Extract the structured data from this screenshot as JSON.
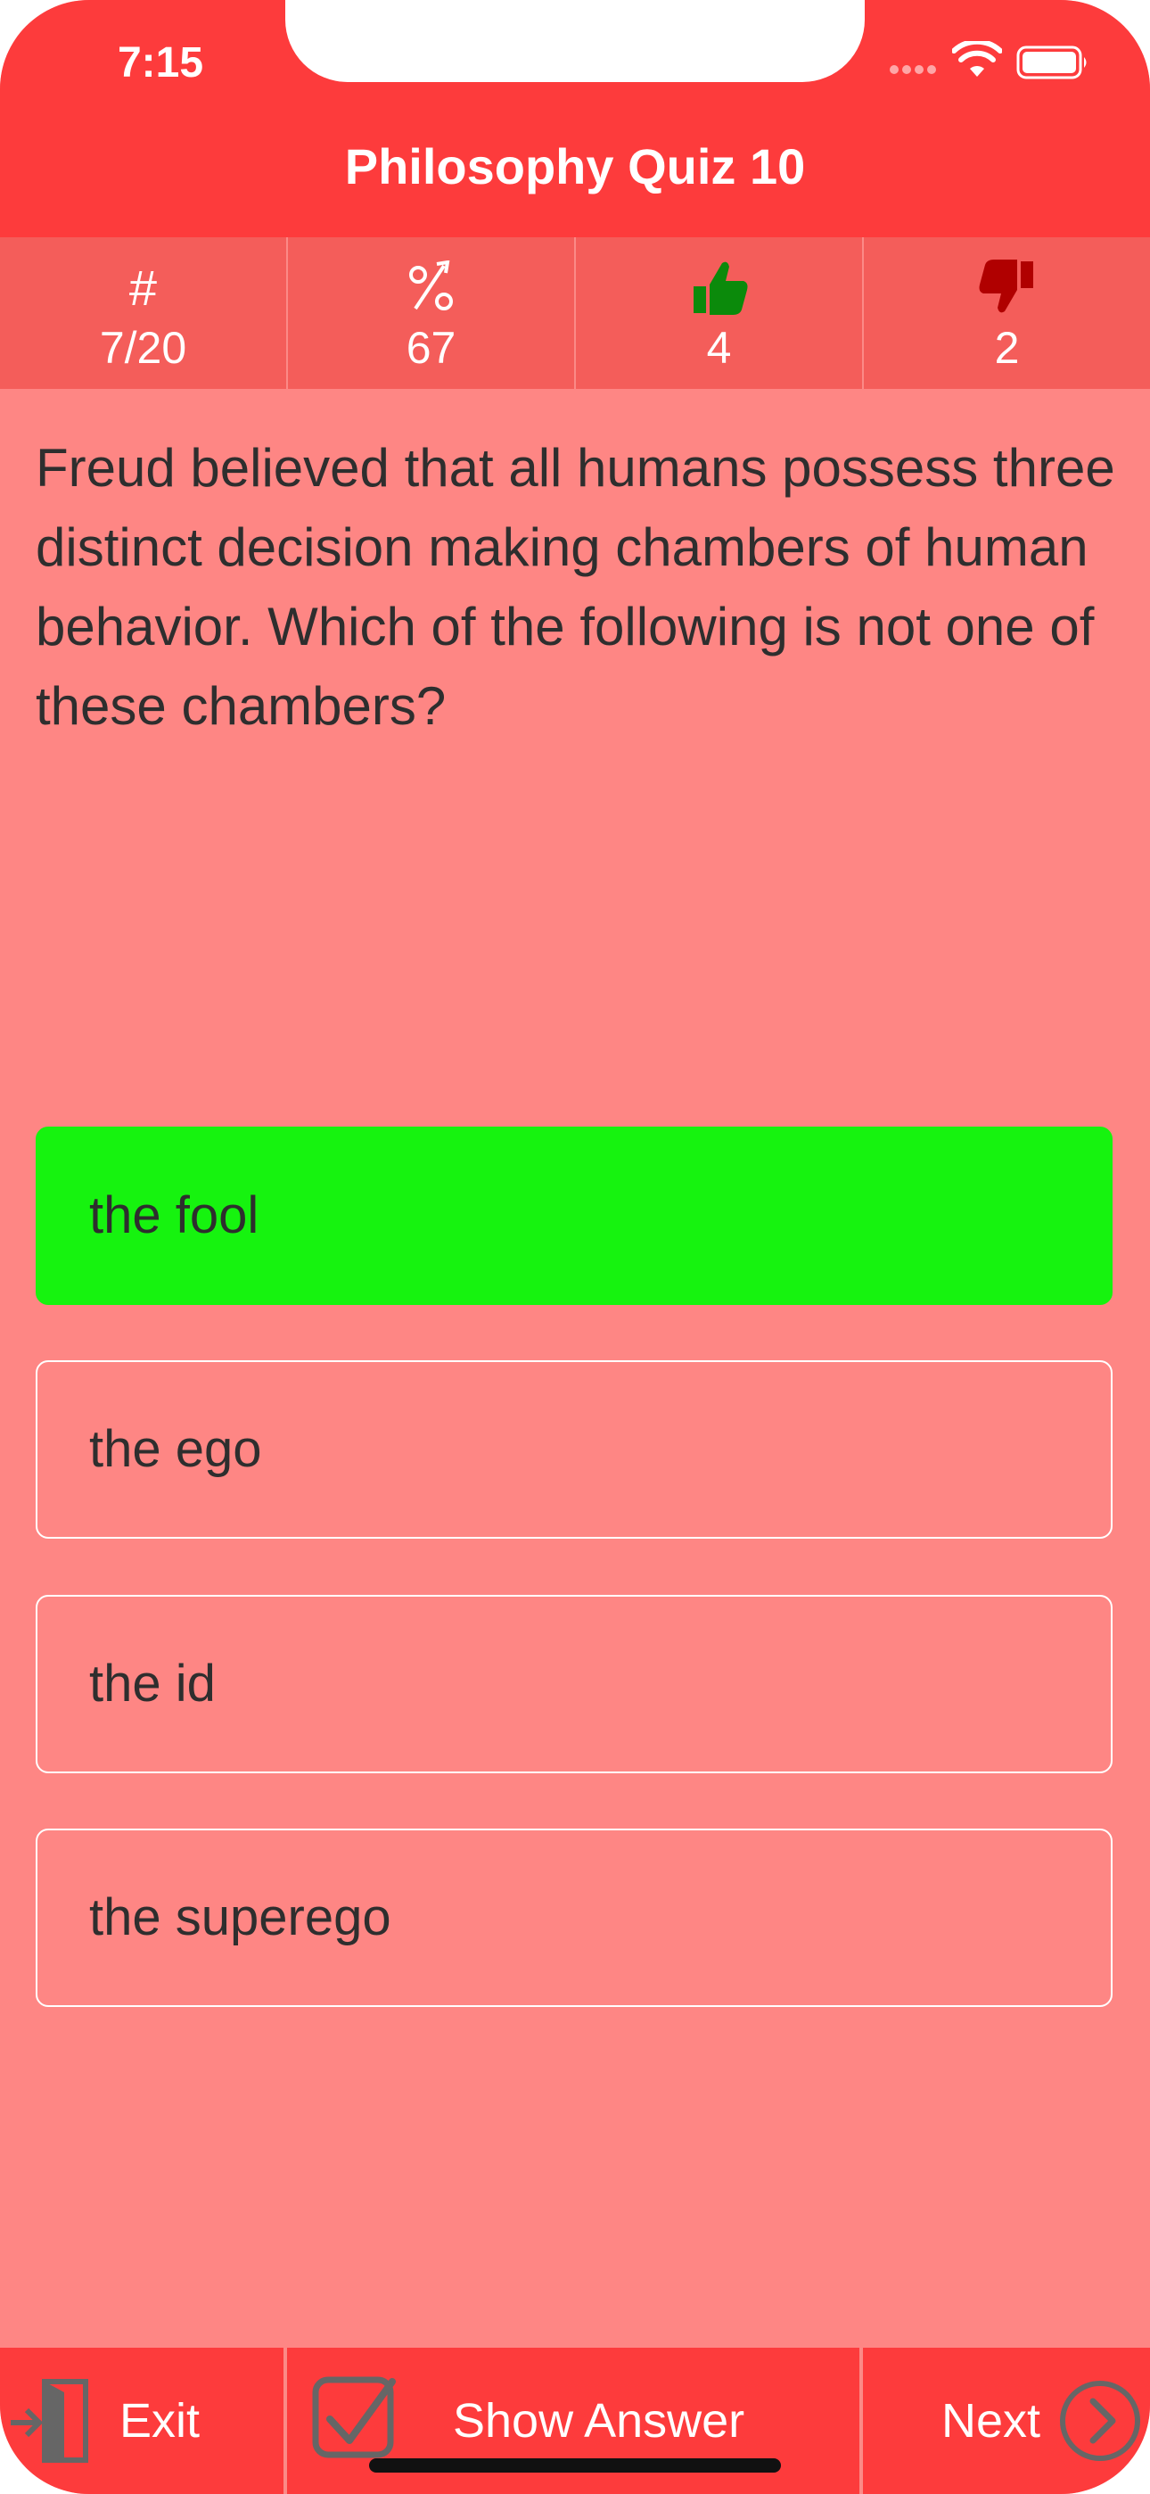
{
  "status_bar": {
    "time": "7:15"
  },
  "header": {
    "title": "Philosophy Quiz 10"
  },
  "stats": [
    {
      "icon": "hash-icon",
      "symbol": "#",
      "value": "7/20"
    },
    {
      "icon": "percent-trend-icon",
      "symbol": "%",
      "value": "67"
    },
    {
      "icon": "thumbs-up-icon",
      "value": "4"
    },
    {
      "icon": "thumbs-down-icon",
      "value": "2"
    }
  ],
  "question": "Freud believed that all humans possess three distinct decision making chambers of human behavior. Which of the following is not one of these chambers?",
  "answers": [
    {
      "label": "the fool",
      "selected": true
    },
    {
      "label": "the ego",
      "selected": false
    },
    {
      "label": "the id",
      "selected": false
    },
    {
      "label": "the superego",
      "selected": false
    }
  ],
  "toolbar": {
    "exit_label": "Exit",
    "show_answer_label": "Show Answer",
    "next_label": "Next"
  },
  "colors": {
    "header": "#fd3b3c",
    "stats_bar": "#f45d5a",
    "background": "#fe8684",
    "selected_answer": "#16f30f",
    "thumbs_up": "#0b8a0b",
    "thumbs_down": "#b00000"
  }
}
